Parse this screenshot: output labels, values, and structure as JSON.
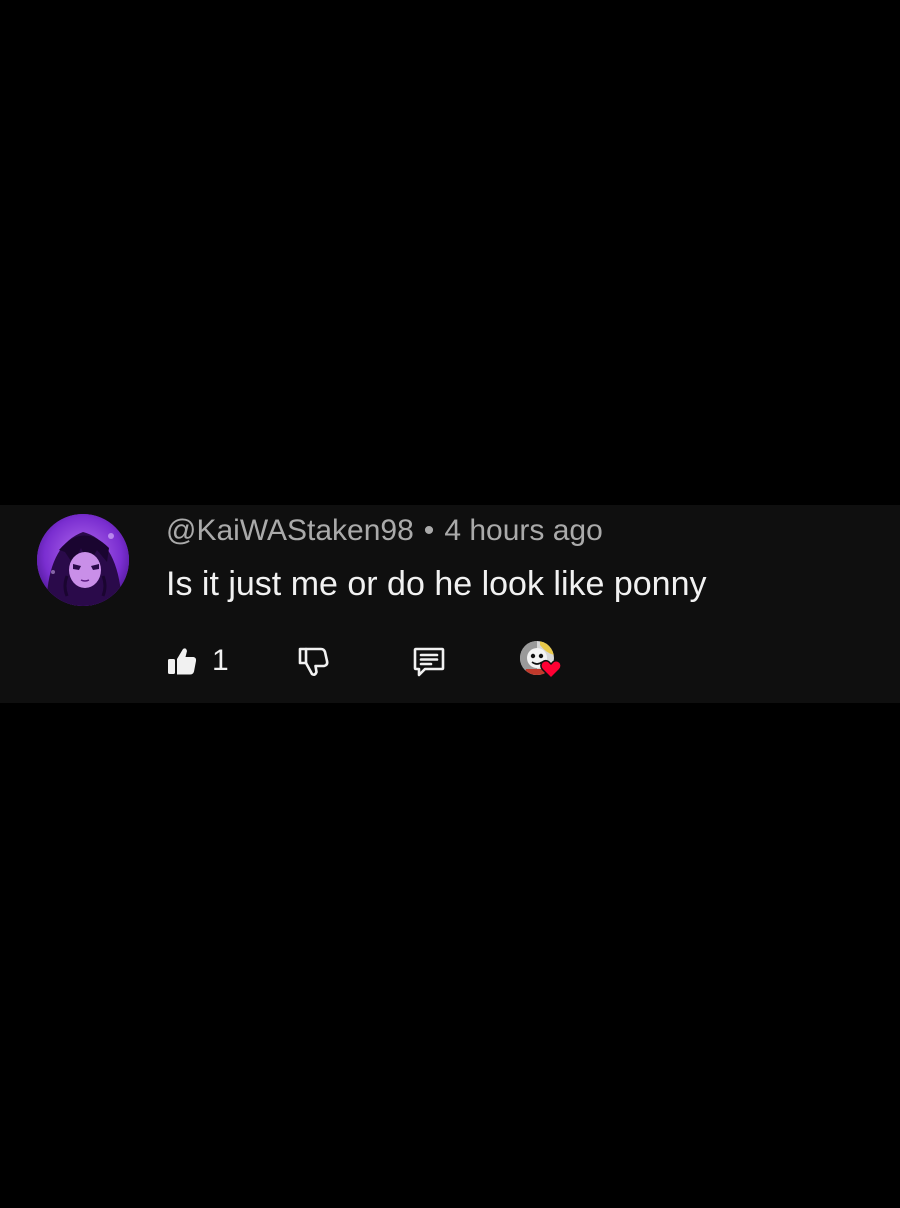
{
  "comment": {
    "username": "@KaiWAStaken98",
    "separator": "•",
    "timestamp": "4 hours ago",
    "text": "Is it just me or do he look like ponny",
    "like_count": "1",
    "avatar_icon": "anime-character-avatar",
    "creator_heart_icon": "creator-heart-icon"
  },
  "colors": {
    "background": "#000000",
    "card": "#0f0f0f",
    "meta_text": "#aaaaaa",
    "primary_text": "#f1f1f1",
    "heart": "#ff0033",
    "avatar_purple": "#7b2fc9"
  }
}
